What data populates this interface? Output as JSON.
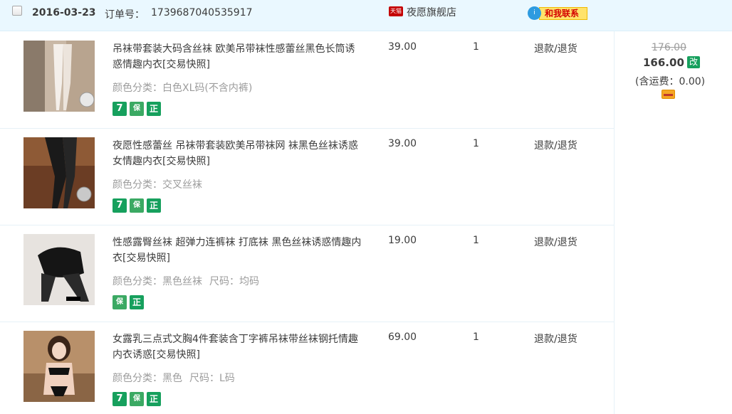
{
  "order": {
    "date": "2016-03-23",
    "number_label": "订单号：",
    "number": "1739687040535917",
    "shop_badge": "天猫",
    "shop_name": "夜愿旗舰店",
    "contact_label": "和我联系",
    "contact_badge": "i"
  },
  "items": [
    {
      "title": "吊袜带套装大码含丝袜 欧美吊带袜性感蕾丝黑色长筒诱惑情趣内衣[交易快照]",
      "sku": "颜色分类：白色XL码(不含内裤)",
      "sku2": "",
      "price": "39.00",
      "qty": "1",
      "action": "退款/退货",
      "tags": [
        "7",
        "保",
        "正"
      ]
    },
    {
      "title": "夜愿性感蕾丝 吊袜带套装欧美吊带袜网 袜黑色丝袜诱惑女情趣内衣[交易快照]",
      "sku": "颜色分类：交叉丝袜",
      "sku2": "",
      "price": "39.00",
      "qty": "1",
      "action": "退款/退货",
      "tags": [
        "7",
        "保",
        "正"
      ]
    },
    {
      "title": "性感露臀丝袜 超弹力连裤袜 打底袜 黑色丝袜诱惑情趣内衣[交易快照]",
      "sku": "颜色分类：黑色丝袜",
      "sku2": "尺码：均码",
      "price": "19.00",
      "qty": "1",
      "action": "退款/退货",
      "tags": [
        "保",
        "正"
      ]
    },
    {
      "title": "女露乳三点式文胸4件套装含丁字裤吊袜带丝袜钢托情趣内衣诱惑[交易快照]",
      "sku": "颜色分类：黑色",
      "sku2": "尺码：L码",
      "price": "69.00",
      "qty": "1",
      "action": "退款/退货",
      "tags": [
        "7",
        "保",
        "正"
      ]
    }
  ],
  "summary": {
    "original_price": "176.00",
    "total": "166.00",
    "modify_label": "改",
    "shipping": "(含运费：0.00)"
  }
}
